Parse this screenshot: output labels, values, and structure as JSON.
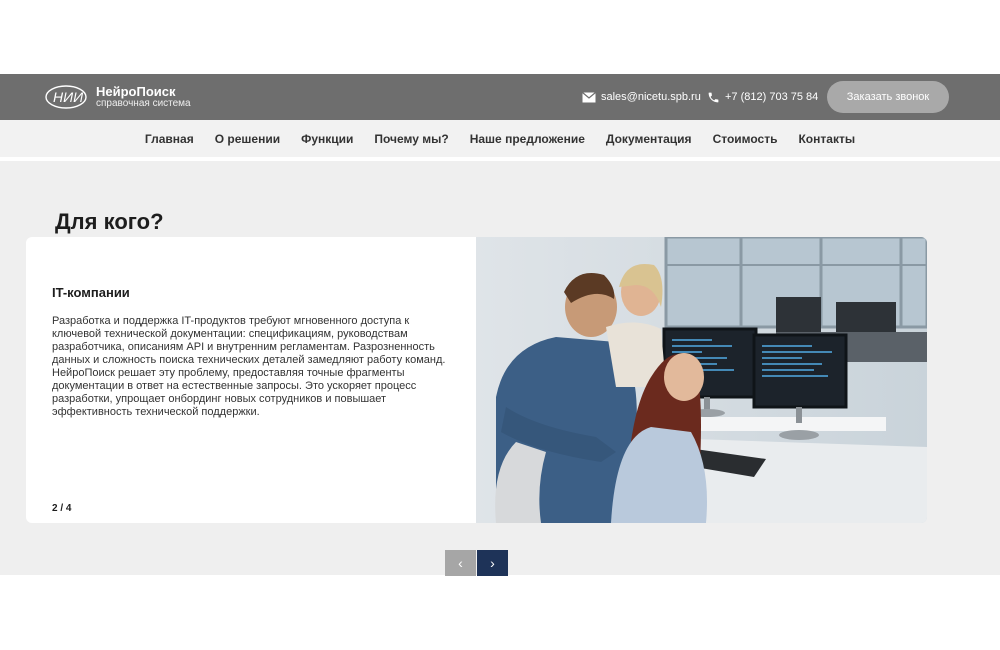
{
  "header": {
    "logo_mark": "НИИ",
    "logo_title": "НейроПоиск",
    "logo_subtitle": "справочная система",
    "email": "sales@nicetu.spb.ru",
    "phone": "+7 (812) 703 75 84",
    "cta_label": "Заказать звонок"
  },
  "nav": {
    "items": [
      "Главная",
      "О решении",
      "Функции",
      "Почему мы?",
      "Наше предложение",
      "Документация",
      "Стоимость",
      "Контакты"
    ]
  },
  "section": {
    "title": "Для кого?"
  },
  "slide": {
    "heading": "IT-компании",
    "text": "Разработка и поддержка IT-продуктов требуют мгновенного доступа к ключевой технической документации: спецификациям, руководствам разработчика, описаниям API и внутренним регламентам. Разрозненность данных и сложность поиска технических деталей замедляют работу команд. НейроПоиск решает эту проблему, предоставляя точные фрагменты документации в ответ на естественные запросы. Это ускоряет процесс разработки, упрощает онбординг новых сотрудников и повышает эффективность технической поддержки.",
    "counter": "2 / 4"
  },
  "slider_controls": {
    "prev_icon": "chevron-left-icon",
    "next_icon": "chevron-right-icon"
  },
  "colors": {
    "topbar": "#6e6e6e",
    "cta": "#a9a9a9",
    "next_button": "#1e3358",
    "prev_button": "#a6a6a6"
  }
}
